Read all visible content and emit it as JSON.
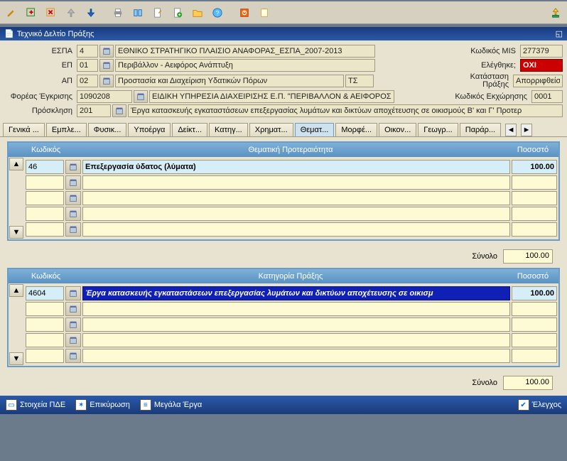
{
  "window": {
    "title": "Τεχνικό Δελτίο Πράξης"
  },
  "toolbar": {
    "icons": [
      "pencil-icon",
      "grid-plus-icon",
      "grid-x-icon",
      "arrow-up-icon",
      "arrow-down-icon",
      "printer-icon",
      "book-icon",
      "doc-edit-icon",
      "doc-plus-icon",
      "folder-icon",
      "help-icon",
      "exit-icon",
      "notepad-icon"
    ],
    "right_icon": "export-up-icon"
  },
  "form": {
    "espa": {
      "label": "ΕΣΠΑ",
      "code": "4",
      "desc": "ΕΘΝΙΚΟ ΣΤΡΑΤΗΓΙΚΟ ΠΛΑΙΣΙΟ ΑΝΑΦΟΡΑΣ_ΕΣΠΑ_2007-2013"
    },
    "ep": {
      "label": "ΕΠ",
      "code": "01",
      "desc": "Περιβάλλον - Αειφόρος Ανάπτυξη"
    },
    "ap": {
      "label": "ΑΠ",
      "code": "02",
      "desc": "Προστασία και Διαχείριση Υδατικών Πόρων",
      "ts": "ΤΣ"
    },
    "foreas": {
      "label": "Φορέας Έγκρισης",
      "code": "1090208",
      "desc": "ΕΙΔΙΚΗ ΥΠΗΡΕΣΙΑ ΔΙΑΧΕΙΡΙΣΗΣ Ε.Π. \"ΠΕΡΙΒΑΛΛΟΝ & ΑΕΙΦΟΡΟΣ ΑΝ"
    },
    "prosklisi": {
      "label": "Πρόσκληση",
      "code": "201",
      "desc": "Έργα κατασκευής εγκαταστάσεων επεξεργασίας λυμάτων και δικτύων αποχέτευσης σε οικισμούς Β' και Γ' Προτερ"
    },
    "mis": {
      "label": "Κωδικός MIS",
      "value": "277379"
    },
    "checked": {
      "label": "Ελέγθηκε;",
      "value": "ΟΧΙ"
    },
    "katastasi": {
      "label": "Κατάσταση",
      "value": "Απορριφθείσα"
    },
    "praxi": {
      "label": "Πράξης"
    },
    "ekxorisi": {
      "label": "Κωδικός Εκχώρησης",
      "value": "0001"
    }
  },
  "tabs": {
    "items": [
      "Γενικά ...",
      "Εμπλε...",
      "Φυσικ...",
      "Υποέργα",
      "Δείκτ...",
      "Κατηγ...",
      "Χρηματ...",
      "Θεματ...",
      "Μορφέ...",
      "Οικον...",
      "Γεωγρ...",
      "Παράρ..."
    ],
    "active_index": 7
  },
  "grid_a": {
    "headers": {
      "code": "Κωδικός",
      "topic": "Θεματική Προτεραιότητα",
      "pct": "Ποσοστό"
    },
    "rows": [
      {
        "code": "46",
        "desc": "Επεξεργασία ύδατος (λύματα)",
        "pct": "100.00"
      },
      {
        "code": "",
        "desc": "",
        "pct": ""
      },
      {
        "code": "",
        "desc": "",
        "pct": ""
      },
      {
        "code": "",
        "desc": "",
        "pct": ""
      },
      {
        "code": "",
        "desc": "",
        "pct": ""
      }
    ],
    "total_label": "Σύνολο",
    "total_value": "100.00"
  },
  "grid_b": {
    "headers": {
      "code": "Κωδικός",
      "cat": "Κατηγορία Πράξης",
      "pct": "Ποσοστό"
    },
    "rows": [
      {
        "code": "4604",
        "desc": "Έργα κατασκευής εγκαταστάσεων επεξεργασίας λυμάτων και δικτύων αποχέτευσης σε οικισμ",
        "pct": "100.00"
      },
      {
        "code": "",
        "desc": "",
        "pct": ""
      },
      {
        "code": "",
        "desc": "",
        "pct": ""
      },
      {
        "code": "",
        "desc": "",
        "pct": ""
      },
      {
        "code": "",
        "desc": "",
        "pct": ""
      }
    ],
    "total_label": "Σύνολο",
    "total_value": "100.00"
  },
  "bottom": {
    "pde": "Στοιχεία ΠΔΕ",
    "epikyrosi": "Επικύρωση",
    "megala": "Μεγάλα Έργα",
    "elegxos": "Έλεγχος"
  }
}
